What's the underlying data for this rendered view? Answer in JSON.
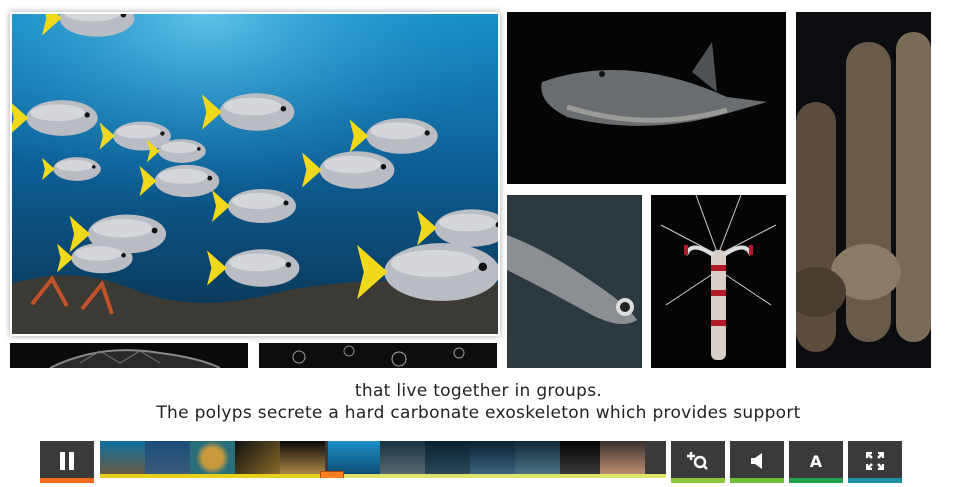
{
  "caption": {
    "line1": "that live together in groups.",
    "line2": "The polyps secrete a hard carbonate exoskeleton which provides support"
  },
  "player": {
    "progress": 0.41,
    "buttons": {
      "play_pause": {
        "icon": "pause-icon",
        "stripe": "#f26b1d"
      },
      "zoom": {
        "icon": "zoom-plus-icon",
        "stripe": "#8cc63f"
      },
      "sound": {
        "icon": "speaker-icon",
        "stripe": "#6bbf3a"
      },
      "text": {
        "label": "A",
        "stripe": "#22a04b"
      },
      "fullscreen": {
        "icon": "fullscreen-icon",
        "stripe": "#1f8fa8"
      }
    }
  },
  "colors": {
    "control_bg": "#3a3a3a",
    "progress_track": "#dfe46a",
    "progress_fill": "#e8d11c",
    "progress_handle": "#ff7e1e"
  }
}
